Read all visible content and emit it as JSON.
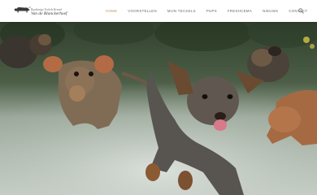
{
  "header": {
    "logo_small": "Ruwharige Teckels Kennel",
    "logo_big": "Van de Blanckerhoef",
    "search_icon": "search-icon"
  },
  "nav": {
    "items": [
      {
        "label": "HOME",
        "active": true
      },
      {
        "label": "VOORSTELLEN",
        "active": false
      },
      {
        "label": "MIJN TECKELS",
        "active": false
      },
      {
        "label": "PUPS",
        "active": false
      },
      {
        "label": "FRESHCEMA",
        "active": false
      },
      {
        "label": "NIEUWS",
        "active": false
      },
      {
        "label": "CONTACT",
        "active": false
      }
    ]
  },
  "colors": {
    "accent": "#b9915a",
    "nav_text": "#666666",
    "header_bg": "#ffffff"
  },
  "hero": {
    "description_icon": "dachshunds-photo"
  }
}
